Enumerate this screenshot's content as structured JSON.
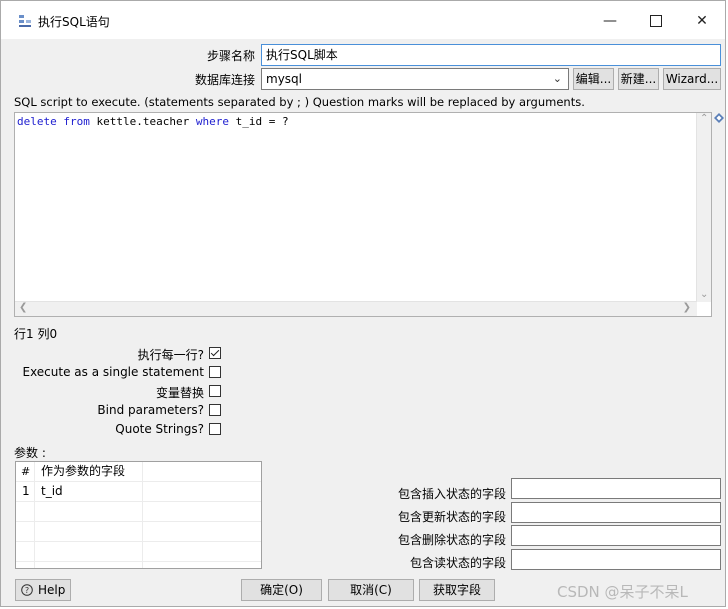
{
  "window": {
    "title": "执行SQL语句",
    "controls": {
      "minimize": "—",
      "close": "✕"
    }
  },
  "step_name": {
    "label": "步骤名称",
    "value": "执行SQL脚本"
  },
  "connection": {
    "label": "数据库连接",
    "value": "mysql",
    "buttons": {
      "edit": "编辑...",
      "new": "新建...",
      "wizard": "Wizard..."
    }
  },
  "sql": {
    "description": "SQL script to execute. (statements separated by ; ) Question marks will be replaced by arguments.",
    "code_tokens": [
      "delete",
      " ",
      "from",
      " kettle.teacher ",
      "where",
      " t_id = ?"
    ]
  },
  "cursor_position": "行1 列0",
  "options": [
    {
      "label": "执行每一行?",
      "checked": true
    },
    {
      "label": "Execute as a single statement",
      "checked": false
    },
    {
      "label": "变量替换",
      "checked": false
    },
    {
      "label": "Bind parameters?",
      "checked": false
    },
    {
      "label": "Quote Strings?",
      "checked": false
    }
  ],
  "params": {
    "label": "参数 :",
    "columns": [
      "#",
      "作为参数的字段"
    ],
    "rows": [
      {
        "num": "1",
        "field": "t_id"
      }
    ]
  },
  "status_fields": [
    {
      "label": "包含插入状态的字段",
      "value": ""
    },
    {
      "label": "包含更新状态的字段",
      "value": ""
    },
    {
      "label": "包含删除状态的字段",
      "value": ""
    },
    {
      "label": "包含读状态的字段",
      "value": ""
    }
  ],
  "footer": {
    "help": "Help",
    "ok": "确定(O)",
    "cancel": "取消(C)",
    "get_fields": "获取字段"
  },
  "watermark": "CSDN @呆子不呆L"
}
